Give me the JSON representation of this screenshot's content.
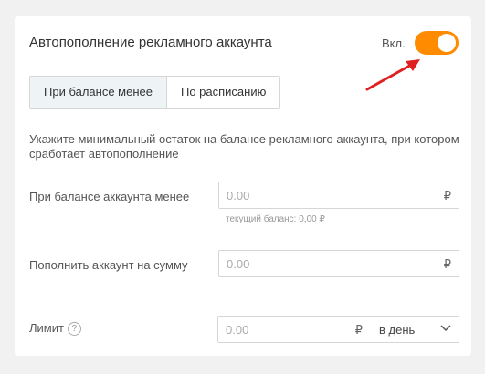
{
  "header": {
    "title": "Автопополнение рекламного аккаунта",
    "toggle_label": "Вкл.",
    "toggle_on": true
  },
  "tabs": [
    {
      "label": "При балансе менее",
      "active": true
    },
    {
      "label": "По расписанию",
      "active": false
    }
  ],
  "hint": "Укажите минимальный остаток на балансе рекламного аккаунта, при котором сработает автопополнение",
  "threshold": {
    "label": "При балансе аккаунта менее",
    "placeholder": "0.00",
    "currency": "₽",
    "current_balance": "текущий баланс: 0,00 ₽"
  },
  "topup": {
    "label": "Пополнить аккаунт на сумму",
    "placeholder": "0.00",
    "currency": "₽"
  },
  "limit": {
    "label": "Лимит",
    "help_symbol": "?",
    "placeholder": "0.00",
    "currency": "₽",
    "period": "в день"
  },
  "colors": {
    "accent": "#ff8c00",
    "arrow": "#e02020",
    "active_tab": "#eef3f6"
  }
}
